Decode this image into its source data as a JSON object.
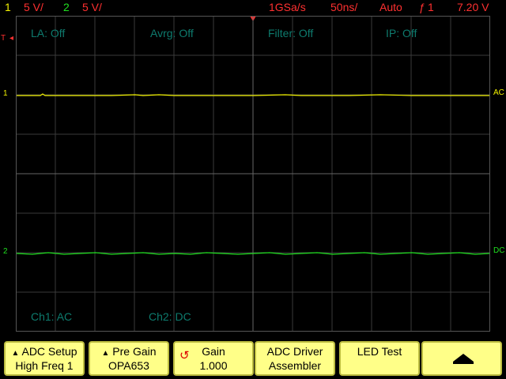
{
  "status": {
    "ch1_index": "1",
    "ch1_scale": "5 V/",
    "ch2_index": "2",
    "ch2_scale": "5 V/",
    "sample_rate": "1GSa/s",
    "timebase": "50ns/",
    "trigger_mode": "Auto",
    "trigger_source": "1",
    "trigger_level": "7.20 V"
  },
  "overlay": {
    "la": "LA: Off",
    "avrg": "Avrg: Off",
    "filter": "Filter: Off",
    "ip": "IP: Off",
    "ch1_coupling": "Ch1: AC",
    "ch2_coupling": "Ch2: DC"
  },
  "markers": {
    "trig": "T",
    "ch1": "1",
    "ch2": "2",
    "ch1_right": "AC",
    "ch2_right": "DC"
  },
  "softkeys": [
    {
      "line1": "ADC Setup",
      "line2": "High Freq 1",
      "icon": "triangle-up-icon"
    },
    {
      "line1": "Pre Gain",
      "line2": "OPA653",
      "icon": "triangle-up-icon"
    },
    {
      "line1": "Gain",
      "line2": "1.000",
      "icon": "rotate-knob-icon"
    },
    {
      "line1": "ADC Driver",
      "line2": "Assembler",
      "icon": ""
    },
    {
      "line1": "LED Test",
      "line2": "",
      "icon": ""
    },
    {
      "line1": "",
      "line2": "",
      "icon": "menu-up-arrow-icon"
    }
  ],
  "colors": {
    "ch1": "#f3f300",
    "ch2": "#20e020",
    "accent": "#ff3030",
    "grid": "#3a3a3a",
    "softkey": "#ffff88"
  }
}
